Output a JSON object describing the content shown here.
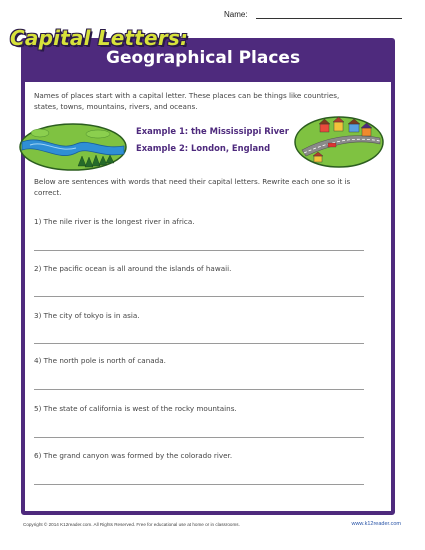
{
  "name_label": "Name:",
  "header": {
    "title": "Capital Letters:",
    "subtitle": "Geographical Places"
  },
  "intro": "Names of places start with a capital letter. These places can be things like countries, states, towns, mountains, rivers, and oceans.",
  "examples": [
    "Example 1: the Mississippi River",
    "Example 2: London, England"
  ],
  "instructions": "Below are sentences with words that need their capital letters. Rewrite each one so it is correct.",
  "questions": [
    "1) The nile river is the longest river in africa.",
    "2) The pacific ocean is all around the islands of hawaii.",
    "3) The city of tokyo is in asia.",
    "4) The north pole is north of canada.",
    "5) The state of california is west of the rocky mountains.",
    "6) The grand canyon was formed by the colorado river."
  ],
  "footer": {
    "copyright": "Copyright © 2014 K12reader.com. All Rights Reserved. Free for educational use at home or in classrooms.",
    "site": "www.k12reader.com"
  },
  "colors": {
    "header_purple": "#4e2a7d",
    "title_yellow": "#d7e23b",
    "example_text": "#4e2a7d"
  },
  "icons": [
    "river-landscape-icon",
    "town-road-icon"
  ]
}
